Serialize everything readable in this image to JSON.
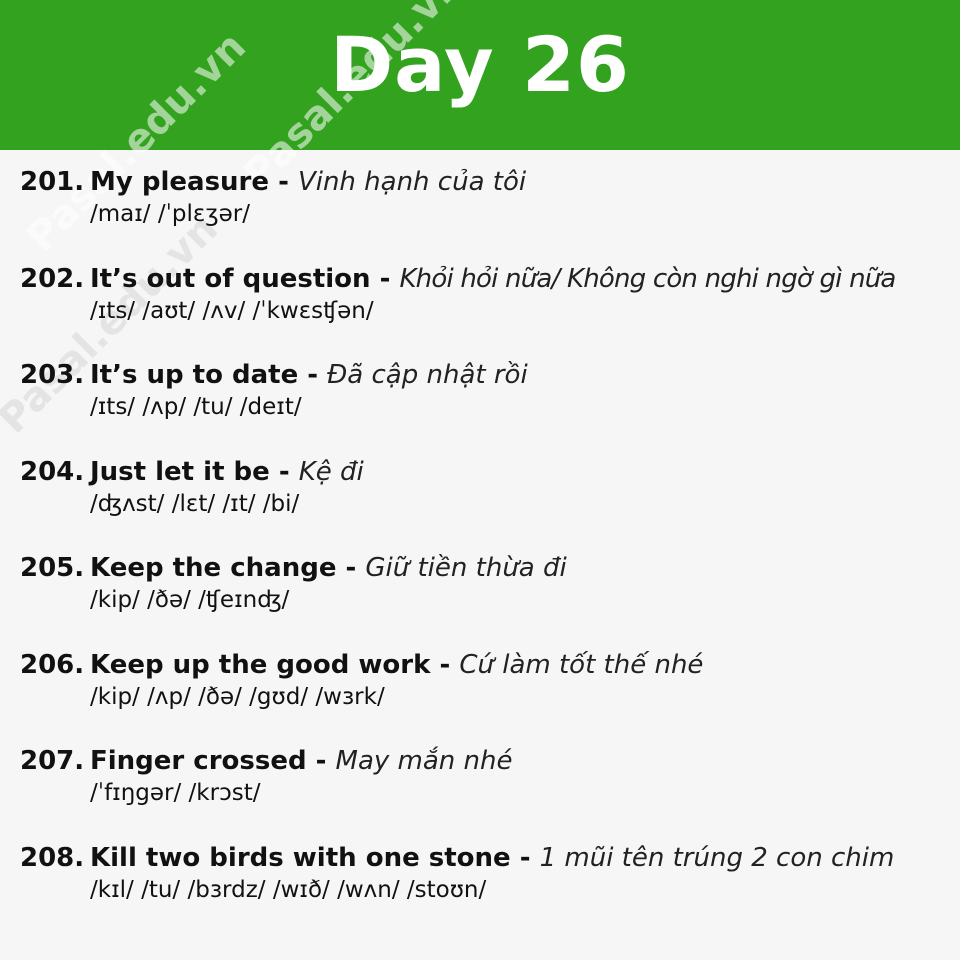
{
  "header": {
    "title": "Day 26",
    "watermark": "Pasal.edu.vn",
    "color": "#33a31f"
  },
  "items": [
    {
      "number": "201.",
      "phrase": "My pleasure",
      "separator": " - ",
      "meaning": "Vinh hạnh của tôi",
      "ipa": "/maɪ/ /ˈplɛʒər/"
    },
    {
      "number": "202.",
      "phrase": "It’s out of question",
      "separator": " - ",
      "meaning": "Khỏi hỏi nữa/ Không còn nghi ngờ gì nữa",
      "ipa": "/ɪts/ /aʊt/ /ʌv/ /ˈkwɛsʧən/"
    },
    {
      "number": "203.",
      "phrase": "It’s up to date",
      "separator": " - ",
      "meaning": "Đã cập nhật rồi",
      "ipa": "/ɪts/ /ʌp/ /tu/ /deɪt/"
    },
    {
      "number": "204.",
      "phrase": "Just let it be",
      "separator": " - ",
      "meaning": "Kệ đi",
      "ipa": "/ʤʌst/ /lɛt/ /ɪt/ /bi/"
    },
    {
      "number": "205.",
      "phrase": "Keep the change",
      "separator": " - ",
      "meaning": "Giữ tiền thừa đi",
      "ipa": "/kip/ /ðə/ /ʧeɪnʤ/"
    },
    {
      "number": "206.",
      "phrase": "Keep up the good work",
      "separator": " - ",
      "meaning": "Cứ làm tốt thế nhé",
      "ipa": "/kip/ /ʌp/ /ðə/ /gʊd/ /wɜrk/"
    },
    {
      "number": "207.",
      "phrase": "Finger crossed",
      "separator": " - ",
      "meaning": "May mắn nhé",
      "ipa": "/ˈfɪŋgər/ /krɔst/"
    },
    {
      "number": "208.",
      "phrase": "Kill two birds with one stone",
      "separator": " - ",
      "meaning": "1 mũi tên trúng 2 con chim",
      "ipa": "/kɪl/ /tu/ /bɜrdz/ /wɪð/ /wʌn/ /stoʊn/"
    }
  ]
}
